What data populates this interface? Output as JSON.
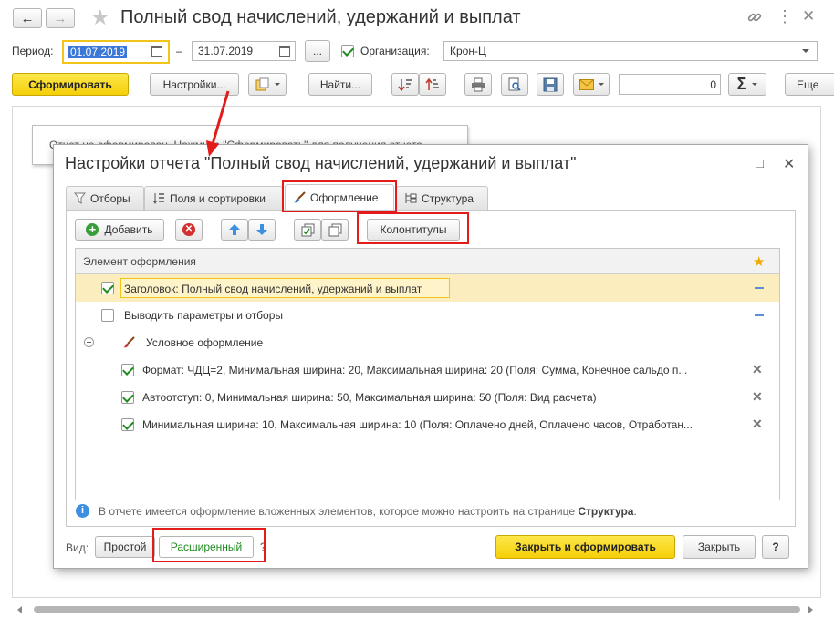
{
  "window": {
    "title": "Полный свод начислений, удержаний и выплат",
    "nav_back": "←",
    "nav_forward": "→",
    "star": "★",
    "link_icon": "link-icon",
    "more_icon": "⋮",
    "close_icon": "✕"
  },
  "filters": {
    "period_label": "Период:",
    "date_from": "01.07.2019",
    "dash": "–",
    "date_to": "31.07.2019",
    "period_button": "...",
    "org_checked": true,
    "org_label": "Организация:",
    "org_value": "Крон-Ц"
  },
  "toolbar": {
    "generate_label": "Сформировать",
    "settings_label": "Настройки...",
    "find_label": "Найти...",
    "sum_value": "0",
    "sigma": "Σ",
    "more_label": "Еще"
  },
  "background_report": {
    "hint": "Отчет не сформирован. Нажмите \"Сформировать\" для получения отчета."
  },
  "dialog": {
    "title": "Настройки отчета \"Полный свод начислений, удержаний и выплат\"",
    "maximize_icon": "□",
    "close_icon": "✕",
    "tabs": [
      {
        "label": "Отборы",
        "icon": "filter-icon"
      },
      {
        "label": "Поля и сортировки",
        "icon": "fields-sort-icon"
      },
      {
        "label": "Оформление",
        "icon": "brush-icon",
        "active": true
      },
      {
        "label": "Структура",
        "icon": "structure-icon"
      }
    ],
    "toolbar": {
      "add_label": "Добавить",
      "headers_footers_label": "Колонтитулы"
    },
    "table": {
      "column_header": "Элемент оформления",
      "star": "★",
      "rows": [
        {
          "checked": true,
          "text": "Заголовок: Полный свод начислений, удержаний и выплат",
          "selected": true
        },
        {
          "checked": false,
          "text": "Выводить параметры и отборы"
        },
        {
          "group": true,
          "text": "Условное оформление"
        },
        {
          "checked": true,
          "text": "Формат: ЧДЦ=2, Минимальная ширина: 20, Максимальная ширина: 20 (Поля: Сумма, Конечное сальдо п..."
        },
        {
          "checked": true,
          "text": "Автоотступ: 0, Минимальная ширина: 50, Максимальная ширина: 50 (Поля: Вид расчета)"
        },
        {
          "checked": true,
          "text": "Минимальная ширина: 10, Максимальная ширина: 10 (Поля: Оплачено дней, Оплачено часов, Отработан..."
        }
      ]
    },
    "info_text": "В отчете имеется оформление вложенных элементов, которое можно настроить на странице",
    "info_link": "Структура",
    "info_dot": ".",
    "view_label": "Вид:",
    "view_simple": "Простой",
    "view_extended": "Расширенный",
    "view_help": "?",
    "close_generate_label": "Закрыть и сформировать",
    "close_label": "Закрыть",
    "help_label": "?"
  },
  "colors": {
    "accent_yellow": "#f5d20b",
    "highlight_red": "#e41b1b",
    "selected_row": "#fbedbd",
    "check_green": "#1e8c1e"
  }
}
